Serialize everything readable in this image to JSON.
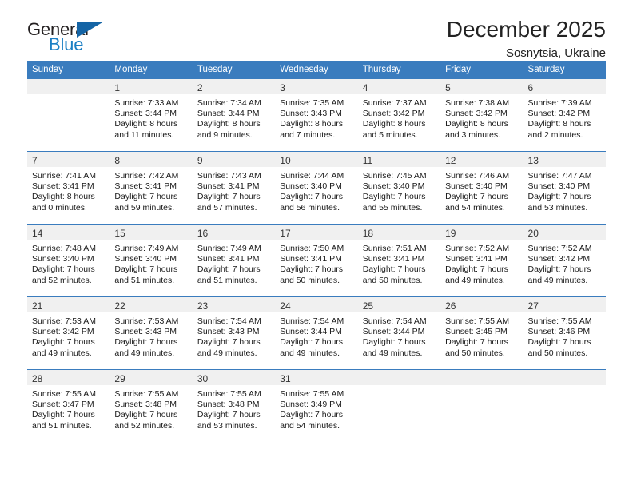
{
  "logo": {
    "word_top": "General",
    "word_bottom": "Blue",
    "triangle_color": "#1464a5",
    "blue_color": "#1b7fc4"
  },
  "header": {
    "month_title": "December 2025",
    "location": "Sosnytsia, Ukraine"
  },
  "theme": {
    "header_band": "#3a7cbe",
    "daynum_band": "#f0f0f0",
    "grid_line": "#3a7cbe"
  },
  "weekday_headers": [
    "Sunday",
    "Monday",
    "Tuesday",
    "Wednesday",
    "Thursday",
    "Friday",
    "Saturday"
  ],
  "weeks": [
    [
      {
        "day": "",
        "sunrise": "",
        "sunset": "",
        "daylight_line1": "",
        "daylight_line2": ""
      },
      {
        "day": "1",
        "sunrise": "Sunrise: 7:33 AM",
        "sunset": "Sunset: 3:44 PM",
        "daylight_line1": "Daylight: 8 hours",
        "daylight_line2": "and 11 minutes."
      },
      {
        "day": "2",
        "sunrise": "Sunrise: 7:34 AM",
        "sunset": "Sunset: 3:44 PM",
        "daylight_line1": "Daylight: 8 hours",
        "daylight_line2": "and 9 minutes."
      },
      {
        "day": "3",
        "sunrise": "Sunrise: 7:35 AM",
        "sunset": "Sunset: 3:43 PM",
        "daylight_line1": "Daylight: 8 hours",
        "daylight_line2": "and 7 minutes."
      },
      {
        "day": "4",
        "sunrise": "Sunrise: 7:37 AM",
        "sunset": "Sunset: 3:42 PM",
        "daylight_line1": "Daylight: 8 hours",
        "daylight_line2": "and 5 minutes."
      },
      {
        "day": "5",
        "sunrise": "Sunrise: 7:38 AM",
        "sunset": "Sunset: 3:42 PM",
        "daylight_line1": "Daylight: 8 hours",
        "daylight_line2": "and 3 minutes."
      },
      {
        "day": "6",
        "sunrise": "Sunrise: 7:39 AM",
        "sunset": "Sunset: 3:42 PM",
        "daylight_line1": "Daylight: 8 hours",
        "daylight_line2": "and 2 minutes."
      }
    ],
    [
      {
        "day": "7",
        "sunrise": "Sunrise: 7:41 AM",
        "sunset": "Sunset: 3:41 PM",
        "daylight_line1": "Daylight: 8 hours",
        "daylight_line2": "and 0 minutes."
      },
      {
        "day": "8",
        "sunrise": "Sunrise: 7:42 AM",
        "sunset": "Sunset: 3:41 PM",
        "daylight_line1": "Daylight: 7 hours",
        "daylight_line2": "and 59 minutes."
      },
      {
        "day": "9",
        "sunrise": "Sunrise: 7:43 AM",
        "sunset": "Sunset: 3:41 PM",
        "daylight_line1": "Daylight: 7 hours",
        "daylight_line2": "and 57 minutes."
      },
      {
        "day": "10",
        "sunrise": "Sunrise: 7:44 AM",
        "sunset": "Sunset: 3:40 PM",
        "daylight_line1": "Daylight: 7 hours",
        "daylight_line2": "and 56 minutes."
      },
      {
        "day": "11",
        "sunrise": "Sunrise: 7:45 AM",
        "sunset": "Sunset: 3:40 PM",
        "daylight_line1": "Daylight: 7 hours",
        "daylight_line2": "and 55 minutes."
      },
      {
        "day": "12",
        "sunrise": "Sunrise: 7:46 AM",
        "sunset": "Sunset: 3:40 PM",
        "daylight_line1": "Daylight: 7 hours",
        "daylight_line2": "and 54 minutes."
      },
      {
        "day": "13",
        "sunrise": "Sunrise: 7:47 AM",
        "sunset": "Sunset: 3:40 PM",
        "daylight_line1": "Daylight: 7 hours",
        "daylight_line2": "and 53 minutes."
      }
    ],
    [
      {
        "day": "14",
        "sunrise": "Sunrise: 7:48 AM",
        "sunset": "Sunset: 3:40 PM",
        "daylight_line1": "Daylight: 7 hours",
        "daylight_line2": "and 52 minutes."
      },
      {
        "day": "15",
        "sunrise": "Sunrise: 7:49 AM",
        "sunset": "Sunset: 3:40 PM",
        "daylight_line1": "Daylight: 7 hours",
        "daylight_line2": "and 51 minutes."
      },
      {
        "day": "16",
        "sunrise": "Sunrise: 7:49 AM",
        "sunset": "Sunset: 3:41 PM",
        "daylight_line1": "Daylight: 7 hours",
        "daylight_line2": "and 51 minutes."
      },
      {
        "day": "17",
        "sunrise": "Sunrise: 7:50 AM",
        "sunset": "Sunset: 3:41 PM",
        "daylight_line1": "Daylight: 7 hours",
        "daylight_line2": "and 50 minutes."
      },
      {
        "day": "18",
        "sunrise": "Sunrise: 7:51 AM",
        "sunset": "Sunset: 3:41 PM",
        "daylight_line1": "Daylight: 7 hours",
        "daylight_line2": "and 50 minutes."
      },
      {
        "day": "19",
        "sunrise": "Sunrise: 7:52 AM",
        "sunset": "Sunset: 3:41 PM",
        "daylight_line1": "Daylight: 7 hours",
        "daylight_line2": "and 49 minutes."
      },
      {
        "day": "20",
        "sunrise": "Sunrise: 7:52 AM",
        "sunset": "Sunset: 3:42 PM",
        "daylight_line1": "Daylight: 7 hours",
        "daylight_line2": "and 49 minutes."
      }
    ],
    [
      {
        "day": "21",
        "sunrise": "Sunrise: 7:53 AM",
        "sunset": "Sunset: 3:42 PM",
        "daylight_line1": "Daylight: 7 hours",
        "daylight_line2": "and 49 minutes."
      },
      {
        "day": "22",
        "sunrise": "Sunrise: 7:53 AM",
        "sunset": "Sunset: 3:43 PM",
        "daylight_line1": "Daylight: 7 hours",
        "daylight_line2": "and 49 minutes."
      },
      {
        "day": "23",
        "sunrise": "Sunrise: 7:54 AM",
        "sunset": "Sunset: 3:43 PM",
        "daylight_line1": "Daylight: 7 hours",
        "daylight_line2": "and 49 minutes."
      },
      {
        "day": "24",
        "sunrise": "Sunrise: 7:54 AM",
        "sunset": "Sunset: 3:44 PM",
        "daylight_line1": "Daylight: 7 hours",
        "daylight_line2": "and 49 minutes."
      },
      {
        "day": "25",
        "sunrise": "Sunrise: 7:54 AM",
        "sunset": "Sunset: 3:44 PM",
        "daylight_line1": "Daylight: 7 hours",
        "daylight_line2": "and 49 minutes."
      },
      {
        "day": "26",
        "sunrise": "Sunrise: 7:55 AM",
        "sunset": "Sunset: 3:45 PM",
        "daylight_line1": "Daylight: 7 hours",
        "daylight_line2": "and 50 minutes."
      },
      {
        "day": "27",
        "sunrise": "Sunrise: 7:55 AM",
        "sunset": "Sunset: 3:46 PM",
        "daylight_line1": "Daylight: 7 hours",
        "daylight_line2": "and 50 minutes."
      }
    ],
    [
      {
        "day": "28",
        "sunrise": "Sunrise: 7:55 AM",
        "sunset": "Sunset: 3:47 PM",
        "daylight_line1": "Daylight: 7 hours",
        "daylight_line2": "and 51 minutes."
      },
      {
        "day": "29",
        "sunrise": "Sunrise: 7:55 AM",
        "sunset": "Sunset: 3:48 PM",
        "daylight_line1": "Daylight: 7 hours",
        "daylight_line2": "and 52 minutes."
      },
      {
        "day": "30",
        "sunrise": "Sunrise: 7:55 AM",
        "sunset": "Sunset: 3:48 PM",
        "daylight_line1": "Daylight: 7 hours",
        "daylight_line2": "and 53 minutes."
      },
      {
        "day": "31",
        "sunrise": "Sunrise: 7:55 AM",
        "sunset": "Sunset: 3:49 PM",
        "daylight_line1": "Daylight: 7 hours",
        "daylight_line2": "and 54 minutes."
      },
      {
        "day": "",
        "sunrise": "",
        "sunset": "",
        "daylight_line1": "",
        "daylight_line2": ""
      },
      {
        "day": "",
        "sunrise": "",
        "sunset": "",
        "daylight_line1": "",
        "daylight_line2": ""
      },
      {
        "day": "",
        "sunrise": "",
        "sunset": "",
        "daylight_line1": "",
        "daylight_line2": ""
      }
    ]
  ]
}
